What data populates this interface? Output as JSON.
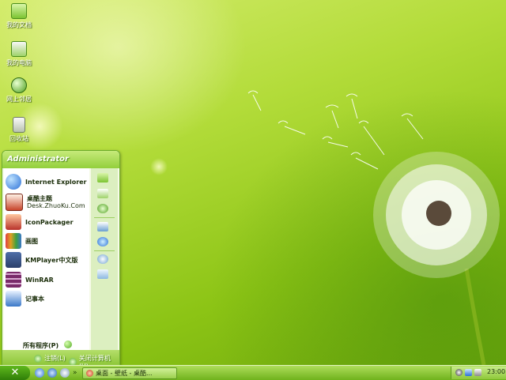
{
  "desktop": {
    "icons": [
      {
        "label": "我的文档",
        "icon": "folder-icon"
      },
      {
        "label": "我的电脑",
        "icon": "home-icon"
      },
      {
        "label": "网上邻居",
        "icon": "network-globe-icon"
      },
      {
        "label": "回收站",
        "icon": "recycle-bin-icon"
      }
    ]
  },
  "start_menu": {
    "user": "Administrator",
    "programs": [
      {
        "label": "Internet Explorer",
        "icon": "internet-explorer-icon",
        "color": "#2a6fd6"
      },
      {
        "label": "桌酷主题",
        "sub": "Desk.ZhuoKu.Com",
        "icon": "theme-icon",
        "color": "#c8452c"
      },
      {
        "label": "IconPackager",
        "icon": "iconpackager-icon",
        "color": "#b8322a"
      },
      {
        "label": "画图",
        "icon": "paint-icon",
        "color": "#e0a020"
      },
      {
        "label": "KMPlayer中文版",
        "icon": "kmplayer-icon",
        "color": "#2b3f6a"
      },
      {
        "label": "WinRAR",
        "icon": "winrar-icon",
        "color": "#7a2a6a"
      },
      {
        "label": "记事本",
        "icon": "notepad-icon",
        "color": "#3a78c8"
      }
    ],
    "all_programs": "所有程序(P)",
    "right_items": [
      "folder-icon",
      "home-icon",
      "network-globe-icon",
      "control-panel-icon",
      "connect-globe-icon",
      "search-icon",
      "run-icon"
    ],
    "logoff": "注销(L)",
    "shutdown": "关闭计算机(U)"
  },
  "taskbar": {
    "start_symbol": "✕",
    "quick_launch": [
      "show-desktop-icon",
      "ie-quicklaunch-icon",
      "media-player-icon"
    ],
    "more": "»",
    "task": "桌面 - 壁纸 - 桌酷...",
    "clock": "23:00"
  },
  "colors": {
    "accent": "#6fb21c",
    "menu_bg": "#f6fbe8"
  }
}
